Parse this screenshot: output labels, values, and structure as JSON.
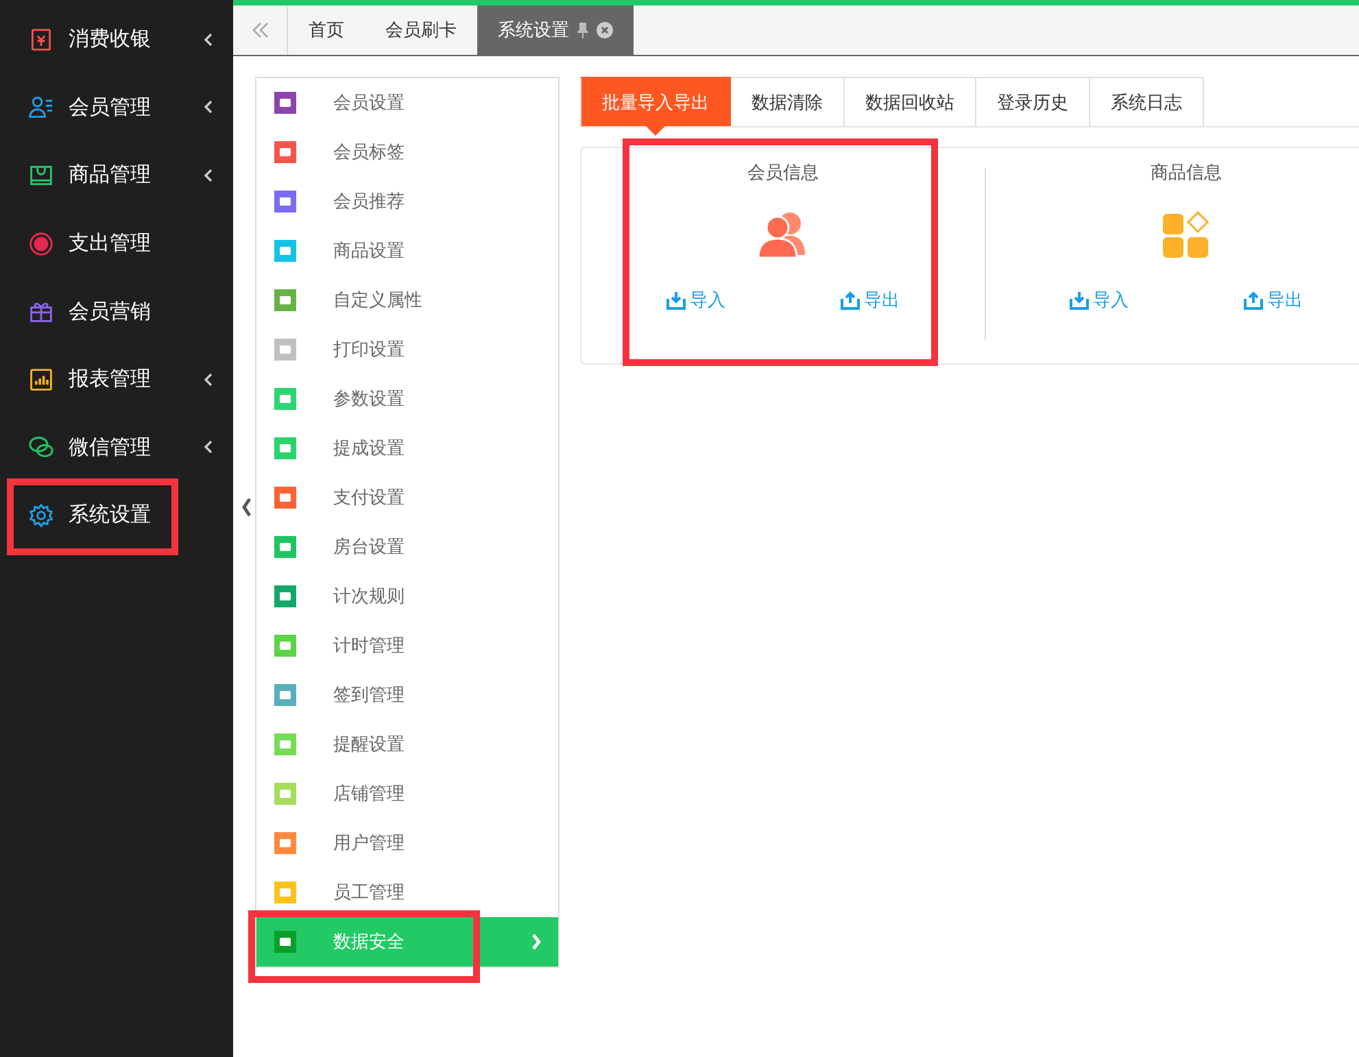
{
  "sidebar": [
    {
      "label": "消费收银",
      "kind": "cashier",
      "expandable": true,
      "highlighted": false
    },
    {
      "label": "会员管理",
      "kind": "members",
      "expandable": true,
      "highlighted": false
    },
    {
      "label": "商品管理",
      "kind": "goods",
      "expandable": true,
      "highlighted": false
    },
    {
      "label": "支出管理",
      "kind": "coin",
      "expandable": false,
      "highlighted": false
    },
    {
      "label": "会员营销",
      "kind": "gift",
      "expandable": false,
      "highlighted": false
    },
    {
      "label": "报表管理",
      "kind": "report",
      "expandable": true,
      "highlighted": false
    },
    {
      "label": "微信管理",
      "kind": "chat",
      "expandable": true,
      "highlighted": false
    },
    {
      "label": "系统设置",
      "kind": "gear",
      "expandable": false,
      "highlighted": true
    }
  ],
  "page_tabs": [
    {
      "label": "首页",
      "selected": false,
      "pinned": false,
      "closable": false
    },
    {
      "label": "会员刷卡",
      "selected": false,
      "pinned": false,
      "closable": false
    },
    {
      "label": "系统设置",
      "selected": true,
      "pinned": true,
      "closable": true
    }
  ],
  "settings_menu": [
    {
      "label": "会员设置",
      "color": "#8e44ad",
      "selected": false,
      "highlighted": false
    },
    {
      "label": "会员标签",
      "color": "#f5564b",
      "selected": false,
      "highlighted": false
    },
    {
      "label": "会员推荐",
      "color": "#7b6cf6",
      "selected": false,
      "highlighted": false
    },
    {
      "label": "商品设置",
      "color": "#15c3e6",
      "selected": false,
      "highlighted": false
    },
    {
      "label": "自定义属性",
      "color": "#67b346",
      "selected": false,
      "highlighted": false
    },
    {
      "label": "打印设置",
      "color": "#c0c0c0",
      "selected": false,
      "highlighted": false
    },
    {
      "label": "参数设置",
      "color": "#2ed573",
      "selected": false,
      "highlighted": false
    },
    {
      "label": "提成设置",
      "color": "#2bd36c",
      "selected": false,
      "highlighted": false
    },
    {
      "label": "支付设置",
      "color": "#ff6233",
      "selected": false,
      "highlighted": false
    },
    {
      "label": "房台设置",
      "color": "#20c561",
      "selected": false,
      "highlighted": false
    },
    {
      "label": "计次规则",
      "color": "#12a86a",
      "selected": false,
      "highlighted": false
    },
    {
      "label": "计时管理",
      "color": "#5bd448",
      "selected": false,
      "highlighted": false
    },
    {
      "label": "签到管理",
      "color": "#5aaeb9",
      "selected": false,
      "highlighted": false
    },
    {
      "label": "提醒设置",
      "color": "#74dc55",
      "selected": false,
      "highlighted": false
    },
    {
      "label": "店铺管理",
      "color": "#a6dd5a",
      "selected": false,
      "highlighted": false
    },
    {
      "label": "用户管理",
      "color": "#ff8a3d",
      "selected": false,
      "highlighted": false
    },
    {
      "label": "员工管理",
      "color": "#ffc21a",
      "selected": false,
      "highlighted": false
    },
    {
      "label": "数据安全",
      "color": "#0a9f2a",
      "selected": true,
      "highlighted": true
    }
  ],
  "sub_tabs": [
    {
      "label": "批量导入导出",
      "selected": true
    },
    {
      "label": "数据清除",
      "selected": false
    },
    {
      "label": "数据回收站",
      "selected": false
    },
    {
      "label": "登录历史",
      "selected": false
    },
    {
      "label": "系统日志",
      "selected": false
    }
  ],
  "panels": [
    {
      "title": "会员信息",
      "kind": "people",
      "import": "导入",
      "export": "导出",
      "highlighted": true
    },
    {
      "title": "商品信息",
      "kind": "blocks",
      "import": "导入",
      "export": "导出",
      "highlighted": false
    }
  ]
}
